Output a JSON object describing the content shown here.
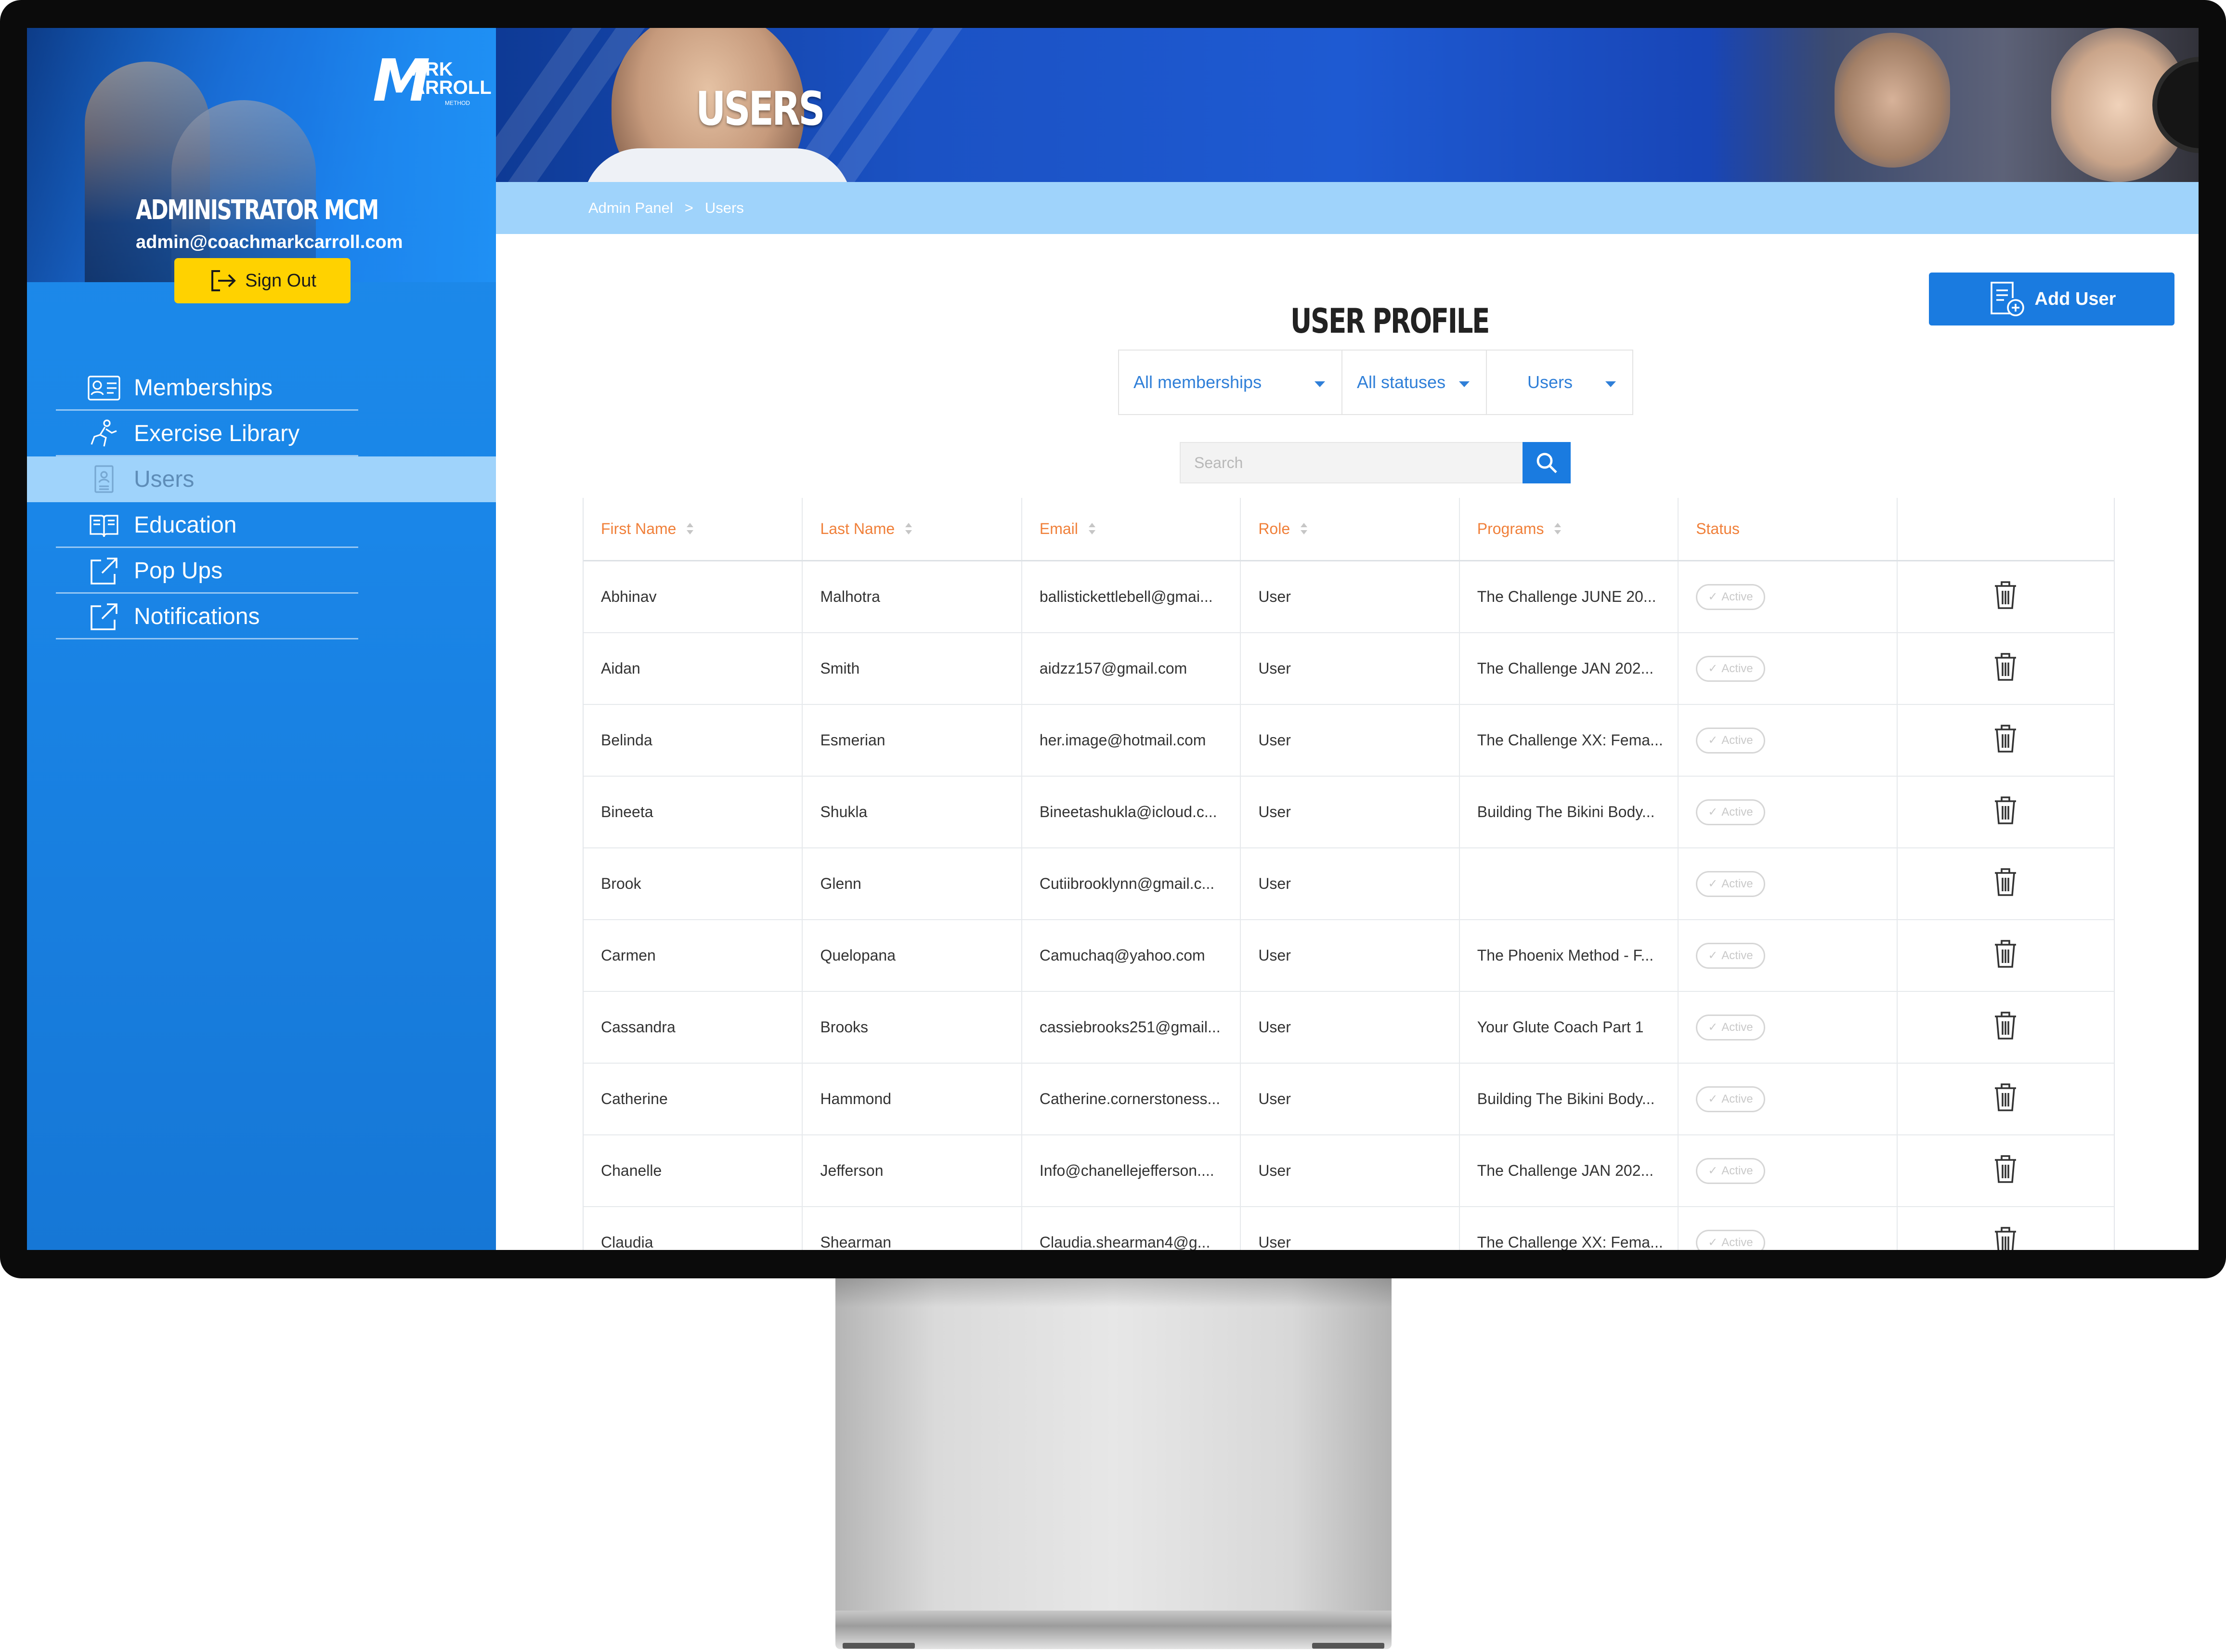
{
  "sidebar": {
    "logo_line1": "ARK",
    "logo_line2": "ARROLL",
    "logo_initial": "M",
    "logo_tag": "METHOD",
    "admin_name": "ADMINISTRATOR MCM",
    "admin_email": "admin@coachmarkcarroll.com",
    "signout_label": "Sign Out",
    "items": [
      {
        "label": "Memberships",
        "icon": "membership-card-icon"
      },
      {
        "label": "Exercise Library",
        "icon": "running-person-icon"
      },
      {
        "label": "Users",
        "icon": "user-document-icon",
        "active": true
      },
      {
        "label": "Education",
        "icon": "book-icon"
      },
      {
        "label": "Pop Ups",
        "icon": "external-link-icon"
      },
      {
        "label": "Notifications",
        "icon": "external-link-icon"
      }
    ]
  },
  "header": {
    "banner_title": "USERS",
    "breadcrumb": [
      "Admin Panel",
      "Users"
    ],
    "breadcrumb_sep": ">"
  },
  "main": {
    "title": "USER PROFILE",
    "add_user_label": "Add User",
    "filters": [
      "All memberships",
      "All statuses",
      "Users"
    ],
    "search_placeholder": "Search",
    "columns": [
      "First Name",
      "Last Name",
      "Email",
      "Role",
      "Programs",
      "Status"
    ],
    "rows": [
      {
        "first": "Abhinav",
        "last": "Malhotra",
        "email": "ballistickettlebell@gmai...",
        "role": "User",
        "program": "The Challenge JUNE 20...",
        "status": "Active"
      },
      {
        "first": "Aidan",
        "last": "Smith",
        "email": "aidzz157@gmail.com",
        "role": "User",
        "program": "The Challenge JAN 202...",
        "status": "Active"
      },
      {
        "first": "Belinda",
        "last": "Esmerian",
        "email": "her.image@hotmail.com",
        "role": "User",
        "program": "The Challenge XX: Fema...",
        "status": "Active"
      },
      {
        "first": "Bineeta",
        "last": "Shukla",
        "email": "Bineetashukla@icloud.c...",
        "role": "User",
        "program": "Building The Bikini Body...",
        "status": "Active"
      },
      {
        "first": "Brook",
        "last": "Glenn",
        "email": "Cutiibrooklynn@gmail.c...",
        "role": "User",
        "program": "",
        "status": "Active"
      },
      {
        "first": "Carmen",
        "last": "Quelopana",
        "email": "Camuchaq@yahoo.com",
        "role": "User",
        "program": "The Phoenix Method - F...",
        "status": "Active"
      },
      {
        "first": "Cassandra",
        "last": "Brooks",
        "email": "cassiebrooks251@gmail...",
        "role": "User",
        "program": "Your Glute Coach Part 1",
        "status": "Active"
      },
      {
        "first": "Catherine",
        "last": "Hammond",
        "email": "Catherine.cornerstoness...",
        "role": "User",
        "program": "Building The Bikini Body...",
        "status": "Active"
      },
      {
        "first": "Chanelle",
        "last": "Jefferson",
        "email": "Info@chanellejefferson....",
        "role": "User",
        "program": "The Challenge JAN 202...",
        "status": "Active"
      },
      {
        "first": "Claudia",
        "last": "Shearman",
        "email": "Claudia.shearman4@g...",
        "role": "User",
        "program": "The Challenge XX: Fema...",
        "status": "Active"
      }
    ]
  },
  "colors": {
    "sidebar_blue": "#1a86e8",
    "active_nav": "#9fd3fb",
    "signout_yellow": "#ffd200",
    "primary_button": "#1a7be0",
    "table_header_text": "#f0803a"
  }
}
